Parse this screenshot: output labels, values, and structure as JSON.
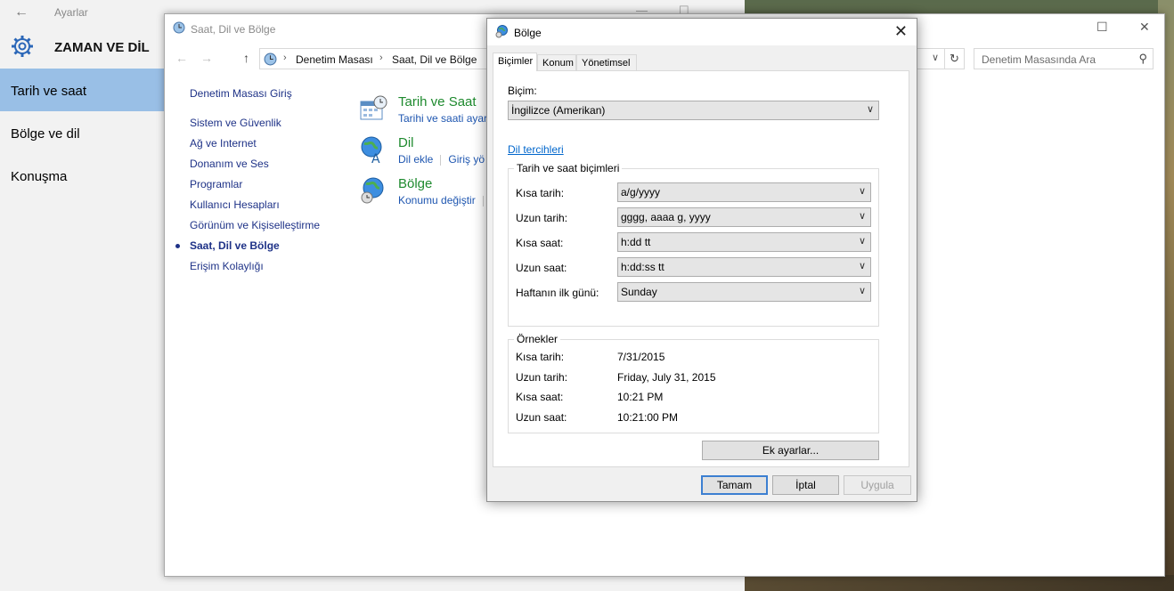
{
  "settings": {
    "app_title": "Ayarlar",
    "section_title": "ZAMAN VE DİL",
    "nav": [
      {
        "label": "Tarih ve saat",
        "active": true
      },
      {
        "label": "Bölge ve dil",
        "active": false
      },
      {
        "label": "Konuşma",
        "active": false
      }
    ]
  },
  "control_panel": {
    "title": "Saat, Dil ve Bölge",
    "breadcrumb": [
      "Denetim Masası",
      "Saat, Dil ve Bölge"
    ],
    "search_placeholder": "Denetim Masasında Ara",
    "left_nav": [
      "Denetim Masası Giriş",
      "Sistem ve Güvenlik",
      "Ağ ve Internet",
      "Donanım ve Ses",
      "Programlar",
      "Kullanıcı Hesapları",
      "Görünüm ve Kişiselleştirme",
      "Saat, Dil ve Bölge",
      "Erişim Kolaylığı"
    ],
    "current_item": "Saat, Dil ve Bölge",
    "categories": [
      {
        "title": "Tarih ve Saat",
        "link1": "Tarihi ve saati ayarl",
        "link2": ""
      },
      {
        "title": "Dil",
        "link1": "Dil ekle",
        "link2": "Giriş yö"
      },
      {
        "title": "Bölge",
        "link1": "Konumu değiştir",
        "link2": ""
      }
    ]
  },
  "dialog": {
    "title": "Bölge",
    "tabs": [
      "Biçimler",
      "Konum",
      "Yönetimsel"
    ],
    "active_tab": "Biçimler",
    "format_label": "Biçim:",
    "format_value": "İngilizce (Amerikan)",
    "lang_prefs_link": "Dil tercihleri",
    "formats_group_title": "Tarih ve saat biçimleri",
    "format_rows": [
      {
        "label": "Kısa tarih:",
        "value": "a/g/yyyy"
      },
      {
        "label": "Uzun tarih:",
        "value": "gggg, aaaa g, yyyy"
      },
      {
        "label": "Kısa saat:",
        "value": "h:dd tt"
      },
      {
        "label": "Uzun saat:",
        "value": "h:dd:ss tt"
      },
      {
        "label": "Haftanın ilk günü:",
        "value": "Sunday"
      }
    ],
    "examples_group_title": "Örnekler",
    "examples": [
      {
        "label": "Kısa tarih:",
        "value": "7/31/2015"
      },
      {
        "label": "Uzun tarih:",
        "value": "Friday, July 31, 2015"
      },
      {
        "label": "Kısa saat:",
        "value": "10:21 PM"
      },
      {
        "label": "Uzun saat:",
        "value": "10:21:00 PM"
      }
    ],
    "additional_settings_button": "Ek ayarlar...",
    "ok_button": "Tamam",
    "cancel_button": "İptal",
    "apply_button": "Uygula"
  },
  "colors": {
    "selection": "#99bfe6",
    "link": "#1e3287",
    "category_title": "#1e8a2e",
    "default_button_border": "#3c7fd1"
  }
}
